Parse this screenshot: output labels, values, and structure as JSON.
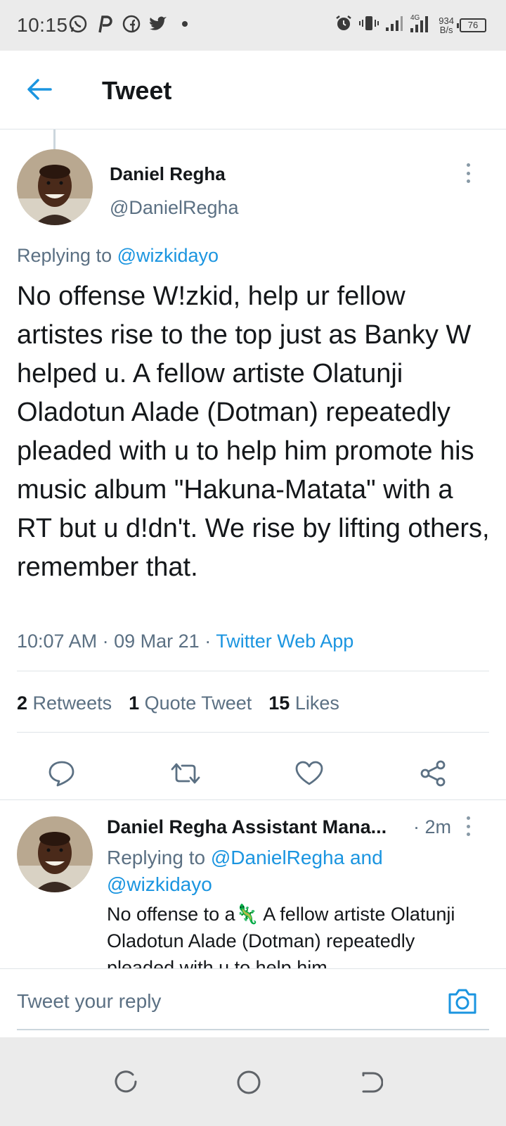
{
  "status_bar": {
    "time": "10:15",
    "speed_value": "934",
    "speed_unit": "B/s",
    "network": "4G",
    "battery": "76",
    "left_icons": [
      "whatsapp-icon",
      "pinterest-icon",
      "facebook-icon",
      "twitter-icon",
      "dot-icon"
    ],
    "right_icons": [
      "alarm-icon",
      "vibrate-icon",
      "signal-icon",
      "signal-4g-icon",
      "battery-icon"
    ]
  },
  "header": {
    "title": "Tweet",
    "back_icon": "arrow-left-icon"
  },
  "tweet": {
    "author_name": "Daniel Regha",
    "author_handle": "@DanielRegha",
    "replying_prefix": "Replying to ",
    "replying_to": "@wizkidayo",
    "text": "No offense W!zkid, help ur fellow artistes rise to the top just as Banky W helped u. A fellow artiste Olatunji Oladotun Alade (Dotman) repeatedly pleaded with u to help him promote his music album \"Hakuna-Matata\" with a RT but u d!dn't. We rise by lifting others, remember that.",
    "time": "10:07 AM",
    "date": "09 Mar 21",
    "source": "Twitter Web App",
    "separator": "·"
  },
  "stats": {
    "retweets_count": "2",
    "retweets_label": "Retweets",
    "quotes_count": "1",
    "quotes_label": "Quote Tweet",
    "likes_count": "15",
    "likes_label": "Likes"
  },
  "actions": [
    "reply-icon",
    "retweet-icon",
    "like-icon",
    "share-icon"
  ],
  "reply": {
    "author_name": "Daniel Regha Assistant Mana...",
    "time": "· 2m",
    "replying_prefix": "Replying to ",
    "replying_to_1": "@DanielRegha",
    "replying_and": " and ",
    "replying_to_2": "@wizkidayo",
    "text_before_emoji": "No offense to a",
    "emoji": "🦎",
    "text_after_emoji": " A fellow artiste Olatunji Oladotun Alade (Dotman) repeatedly pleaded with u to help him"
  },
  "composer": {
    "placeholder": "Tweet your reply",
    "camera_icon": "camera-icon"
  },
  "navbar": [
    "recents-icon",
    "home-icon",
    "back-icon"
  ],
  "colors": {
    "accent": "#1b95e0",
    "secondary_text": "#5b7083",
    "divider": "#dfe4e8"
  }
}
